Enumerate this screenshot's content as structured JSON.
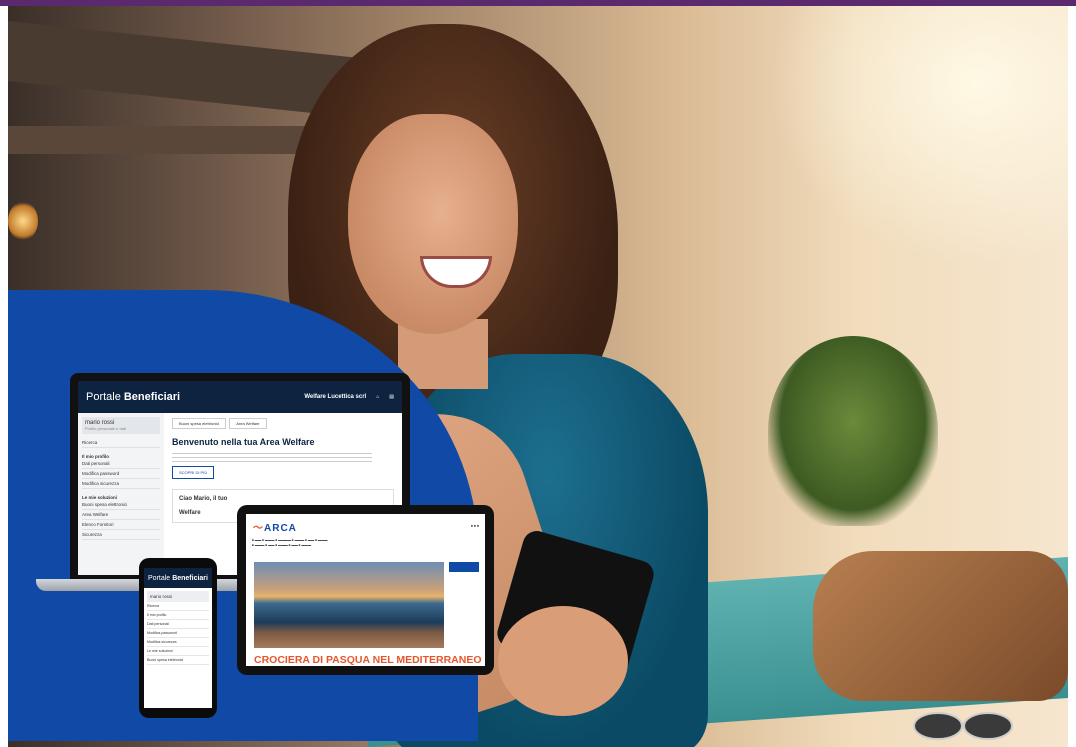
{
  "laptop_app": {
    "brand_light": "Portale",
    "brand_bold": "Beneficiari",
    "company": "Welfare Lucettica scrl",
    "header_icons": [
      "home-icon",
      "document-icon"
    ],
    "tabs": [
      "Buoni spesa elettronici",
      "Area Welfare"
    ],
    "user_name": "mario rossi",
    "user_sub": "Profilo personale e dati",
    "side_items": [
      "Ricerca",
      "Il mio profilo",
      "Dati personali",
      "Modifica password",
      "Modifica sicurezza"
    ],
    "side_section": "Le mie soluzioni",
    "side_items2": [
      "Buoni spesa elettronici",
      "Area Welfare",
      "Elenco Fornitori",
      "Sicurezza"
    ],
    "welcome_title": "Benvenuto nella tua Area Welfare",
    "cta": "SCOPRI DI PIÙ",
    "card_greeting": "Ciao Mario, il tuo",
    "card_label": "Welfare"
  },
  "phone_app": {
    "brand_light": "Portale",
    "brand_bold": "Beneficiari",
    "user_name": "mario rossi",
    "items": [
      "Ricerca",
      "Il mio profilo",
      "Dati personali",
      "Modifica password",
      "Modifica sicurezza",
      "Le mie soluzioni",
      "Buoni spesa elettronici"
    ]
  },
  "tablet_app": {
    "logo": "ARCA",
    "headline": "CROCIERA DI PASQUA NEL MEDITERRANEO"
  },
  "colors": {
    "brand_blue": "#1049a6",
    "navy": "#0d2340",
    "accent_orange": "#e4572e",
    "top_bar": "#5b2a6e"
  }
}
